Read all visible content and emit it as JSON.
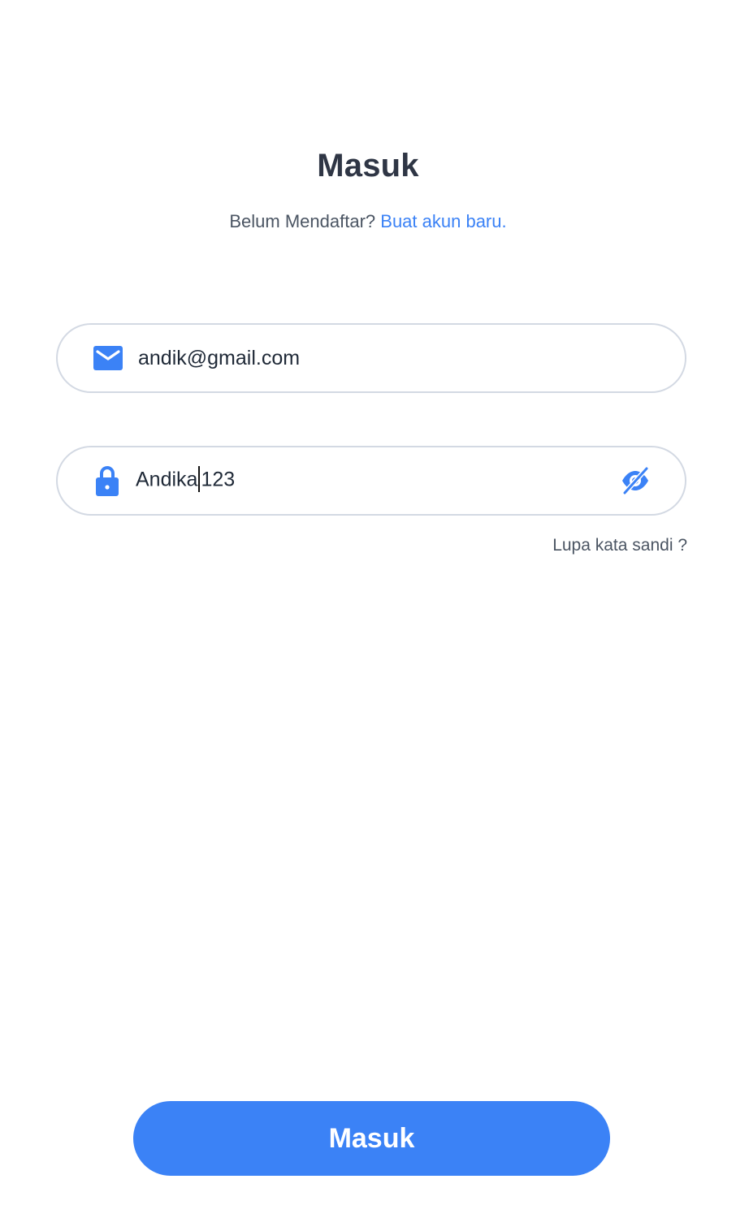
{
  "header": {
    "title": "Masuk",
    "prompt": "Belum Mendaftar?",
    "register_link": "Buat akun baru."
  },
  "form": {
    "email": {
      "icon": "mail-icon",
      "value": "andik@gmail.com"
    },
    "password": {
      "icon": "lock-icon",
      "value_before_caret": "Andika",
      "value_after_caret": "123",
      "toggle_icon": "eye-off-icon"
    },
    "forgot_label": "Lupa kata sandi ?"
  },
  "submit_label": "Masuk",
  "colors": {
    "accent": "#3b82f6",
    "border": "#d3d9e3",
    "title": "#2f3645"
  }
}
